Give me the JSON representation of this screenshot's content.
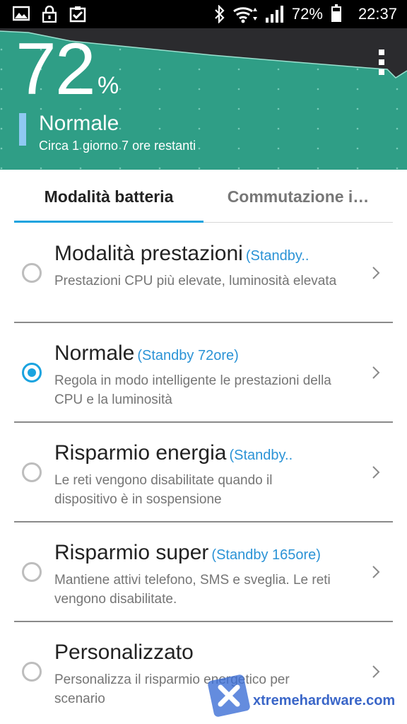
{
  "status_bar": {
    "battery_percent": "72%",
    "time": "22:37",
    "battery_level": 0.72
  },
  "header": {
    "percent": "72",
    "percent_sign": "%",
    "mode": "Normale",
    "remaining": "Circa 1 giorno 7 ore restanti",
    "colors": {
      "background": "#2f9e86",
      "graph_top": "#27272a",
      "mode_bar": "#8fc9f2"
    }
  },
  "tabs": [
    {
      "label": "Modalità batteria",
      "selected": true
    },
    {
      "label": "Commutazione i…",
      "selected": false
    }
  ],
  "modes": [
    {
      "title": "Modalità prestazioni",
      "standby": "(Standby..",
      "description": "Prestazioni CPU più elevate, luminosità elevata",
      "selected": false
    },
    {
      "title": "Normale",
      "standby": "(Standby 72ore)",
      "description": "Regola in modo intelligente le prestazioni della CPU e la luminosità",
      "selected": true
    },
    {
      "title": "Risparmio energia",
      "standby": "(Standby..",
      "description": "Le reti vengono disabilitate quando il dispositivo è in sospensione",
      "selected": false
    },
    {
      "title": "Risparmio super",
      "standby": "(Standby 165ore)",
      "description": "Mantiene attivi telefono, SMS e sveglia. Le reti vengono disabilitate.",
      "selected": false
    },
    {
      "title": "Personalizzato",
      "standby": "",
      "description": "Personalizza il risparmio energetico per scenario",
      "selected": false
    }
  ],
  "watermark": {
    "text": "xtremehardware.com"
  },
  "accent_color": "#1aa3df"
}
